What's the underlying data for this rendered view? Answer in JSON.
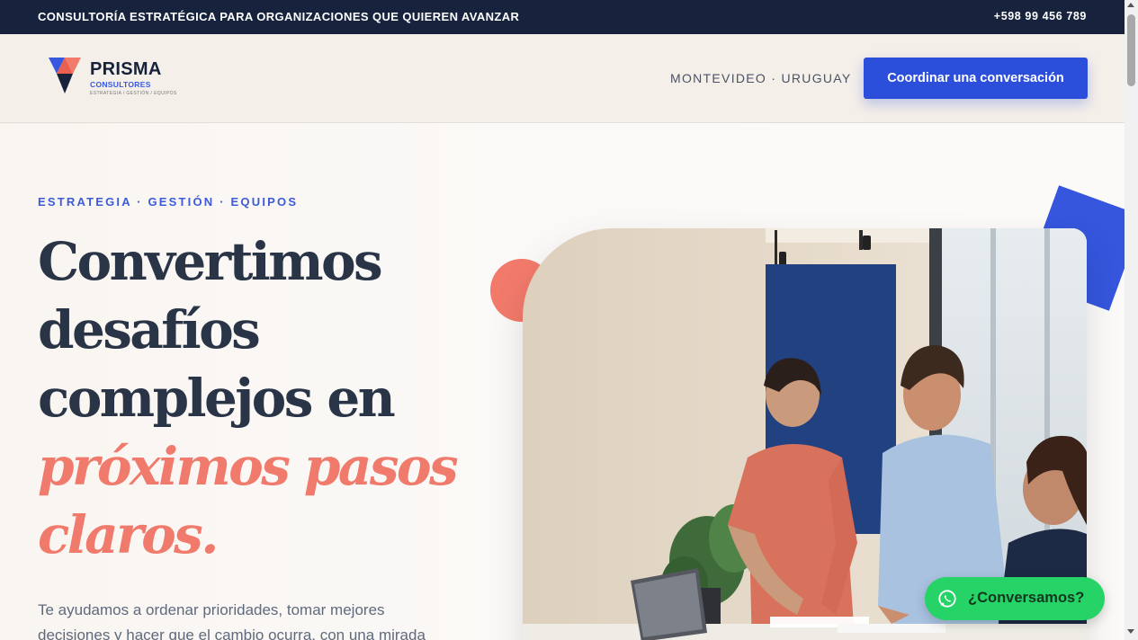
{
  "topbar": {
    "tagline": "CONSULTORÍA ESTRATÉGICA PARA ORGANIZACIONES QUE QUIEREN AVANZAR",
    "phone": "+598 99 456 789"
  },
  "header": {
    "logo": {
      "name": "PRISMA",
      "sub": "CONSULTORES",
      "tagline": "ESTRATEGIA / GESTIÓN / EQUIPOS"
    },
    "location": "MONTEVIDEO · URUGUAY",
    "cta_label": "Coordinar una conversación"
  },
  "hero": {
    "eyebrow": "ESTRATEGIA · GESTIÓN · EQUIPOS",
    "headline": {
      "line1": "Convertimos",
      "line2": "desafíos",
      "line3": "complejos en",
      "accent1": "próximos pasos",
      "accent2": "claros."
    },
    "lead": "Te ayudamos a ordenar prioridades, tomar mejores decisiones y hacer que el cambio ocurra, con una mirada",
    "image_subject": "team-meeting-photo"
  },
  "whatsapp": {
    "label": "¿Conversamos?",
    "icon": "whatsapp-icon"
  },
  "colors": {
    "topbar": "#17233d",
    "accent_blue": "#2b4fdb",
    "accent_coral": "#f07a6c",
    "heading": "#2a3447",
    "whatsapp": "#25d366"
  }
}
